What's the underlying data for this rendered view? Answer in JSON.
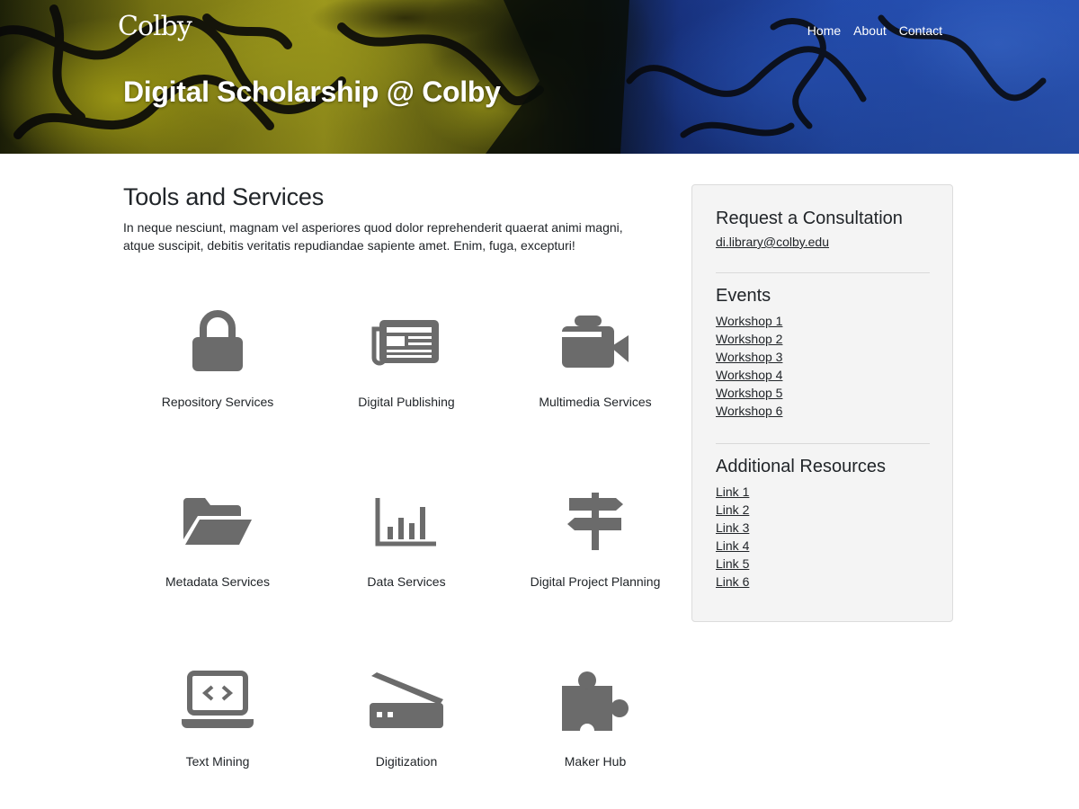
{
  "brand": {
    "logo_text": "Colby"
  },
  "nav": {
    "items": [
      {
        "label": "Home"
      },
      {
        "label": "About"
      },
      {
        "label": "Contact"
      }
    ]
  },
  "hero": {
    "title": "Digital Scholarship @ Colby"
  },
  "main": {
    "title": "Tools and Services",
    "intro": "In neque nesciunt, magnam vel asperiores quod dolor reprehenderit quaerat animi magni, atque suscipit, debitis veritatis repudiandae sapiente amet. Enim, fuga, excepturi!",
    "services": [
      {
        "label": "Repository Services",
        "icon": "lock-icon"
      },
      {
        "label": "Digital Publishing",
        "icon": "newspaper-icon"
      },
      {
        "label": "Multimedia Services",
        "icon": "video-camera-icon"
      },
      {
        "label": "Metadata Services",
        "icon": "folder-open-icon"
      },
      {
        "label": "Data Services",
        "icon": "bar-chart-icon"
      },
      {
        "label": "Digital Project Planning",
        "icon": "signpost-icon"
      },
      {
        "label": "Text Mining",
        "icon": "laptop-code-icon"
      },
      {
        "label": "Digitization",
        "icon": "scanner-icon"
      },
      {
        "label": "Maker Hub",
        "icon": "puzzle-piece-icon"
      }
    ]
  },
  "sidebar": {
    "consultation": {
      "title": "Request a Consultation",
      "email": "di.library@colby.edu"
    },
    "events": {
      "title": "Events",
      "items": [
        "Workshop 1",
        "Workshop 2",
        "Workshop 3",
        "Workshop 4",
        "Workshop 5",
        "Workshop 6"
      ]
    },
    "resources": {
      "title": "Additional Resources",
      "items": [
        "Link 1",
        "Link 2",
        "Link 3",
        "Link 4",
        "Link 5",
        "Link 6"
      ]
    }
  },
  "colors": {
    "icon": "#6b6b6b",
    "sidebar_bg": "#f4f4f4",
    "text": "#212529"
  }
}
